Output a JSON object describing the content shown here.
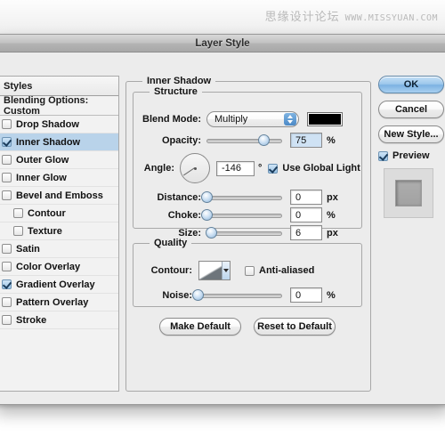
{
  "watermark": {
    "cn": "思缘设计论坛",
    "url": "WWW.MISSYUAN.COM"
  },
  "window": {
    "title": "Layer Style"
  },
  "styles_panel": {
    "header": "Styles",
    "blending_options": "Blending Options: Custom",
    "effects": [
      {
        "label": "Drop Shadow",
        "checked": false,
        "selected": false,
        "sub": false
      },
      {
        "label": "Inner Shadow",
        "checked": true,
        "selected": true,
        "sub": false
      },
      {
        "label": "Outer Glow",
        "checked": false,
        "selected": false,
        "sub": false
      },
      {
        "label": "Inner Glow",
        "checked": false,
        "selected": false,
        "sub": false
      },
      {
        "label": "Bevel and Emboss",
        "checked": false,
        "selected": false,
        "sub": false
      },
      {
        "label": "Contour",
        "checked": false,
        "selected": false,
        "sub": true
      },
      {
        "label": "Texture",
        "checked": false,
        "selected": false,
        "sub": true
      },
      {
        "label": "Satin",
        "checked": false,
        "selected": false,
        "sub": false
      },
      {
        "label": "Color Overlay",
        "checked": false,
        "selected": false,
        "sub": false
      },
      {
        "label": "Gradient Overlay",
        "checked": true,
        "selected": false,
        "sub": false
      },
      {
        "label": "Pattern Overlay",
        "checked": false,
        "selected": false,
        "sub": false
      },
      {
        "label": "Stroke",
        "checked": false,
        "selected": false,
        "sub": false
      }
    ]
  },
  "main": {
    "effect_title": "Inner Shadow",
    "structure": {
      "legend": "Structure",
      "blend_mode_label": "Blend Mode:",
      "blend_mode_value": "Multiply",
      "shadow_color": "#000000",
      "opacity_label": "Opacity:",
      "opacity_value": "75",
      "opacity_unit": "%",
      "opacity_percent": 75,
      "angle_label": "Angle:",
      "angle_value": "-146",
      "angle_unit": "°",
      "angle_degrees": -146,
      "global_light_label": "Use Global Light",
      "global_light_checked": true,
      "distance_label": "Distance:",
      "distance_value": "0",
      "distance_unit": "px",
      "distance_percent": 0,
      "choke_label": "Choke:",
      "choke_value": "0",
      "choke_unit": "%",
      "choke_percent": 0,
      "size_label": "Size:",
      "size_value": "6",
      "size_unit": "px",
      "size_percent": 6
    },
    "quality": {
      "legend": "Quality",
      "contour_label": "Contour:",
      "anti_aliased_label": "Anti-aliased",
      "anti_aliased_checked": false,
      "noise_label": "Noise:",
      "noise_value": "0",
      "noise_unit": "%",
      "noise_percent": 0
    },
    "make_default": "Make Default",
    "reset_to_default": "Reset to Default"
  },
  "right": {
    "ok": "OK",
    "cancel": "Cancel",
    "new_style": "New Style...",
    "preview_label": "Preview",
    "preview_checked": true
  }
}
